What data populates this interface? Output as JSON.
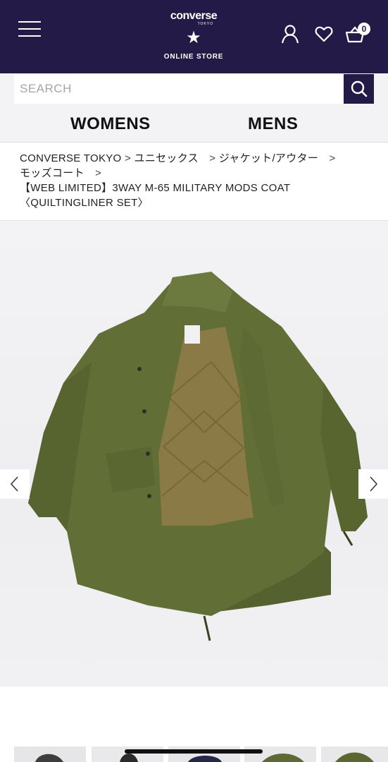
{
  "header": {
    "brand": "converse",
    "brand_sub": "TOKYO",
    "store_label": "ONLINE STORE",
    "cart_count": "0",
    "icons": [
      "menu-icon",
      "user-icon",
      "heart-icon",
      "cart-icon"
    ],
    "background_color": "#231a48"
  },
  "search": {
    "placeholder": "SEARCH",
    "button_icon": "search-icon"
  },
  "gender_nav": {
    "women_label": "WOMENS",
    "men_label": "MENS"
  },
  "breadcrumb": {
    "items": [
      {
        "label": "CONVERSE TOKYO",
        "sep": " > "
      },
      {
        "label": "ユニセックス",
        "sep": "　> "
      },
      {
        "label": "ジャケット/アウター",
        "sep": "　>"
      },
      {
        "label": "モッズコート",
        "sep": "　>"
      }
    ],
    "current": "【WEB LIMITED】3WAY M-65 MILITARY MODS COAT〈QUILTINGLINER SET〉"
  },
  "product": {
    "image_icon": "product-photo-mods-coat",
    "prev_icon": "chevron-left-icon",
    "next_icon": "chevron-right-icon",
    "thumbnail_count": 5
  }
}
